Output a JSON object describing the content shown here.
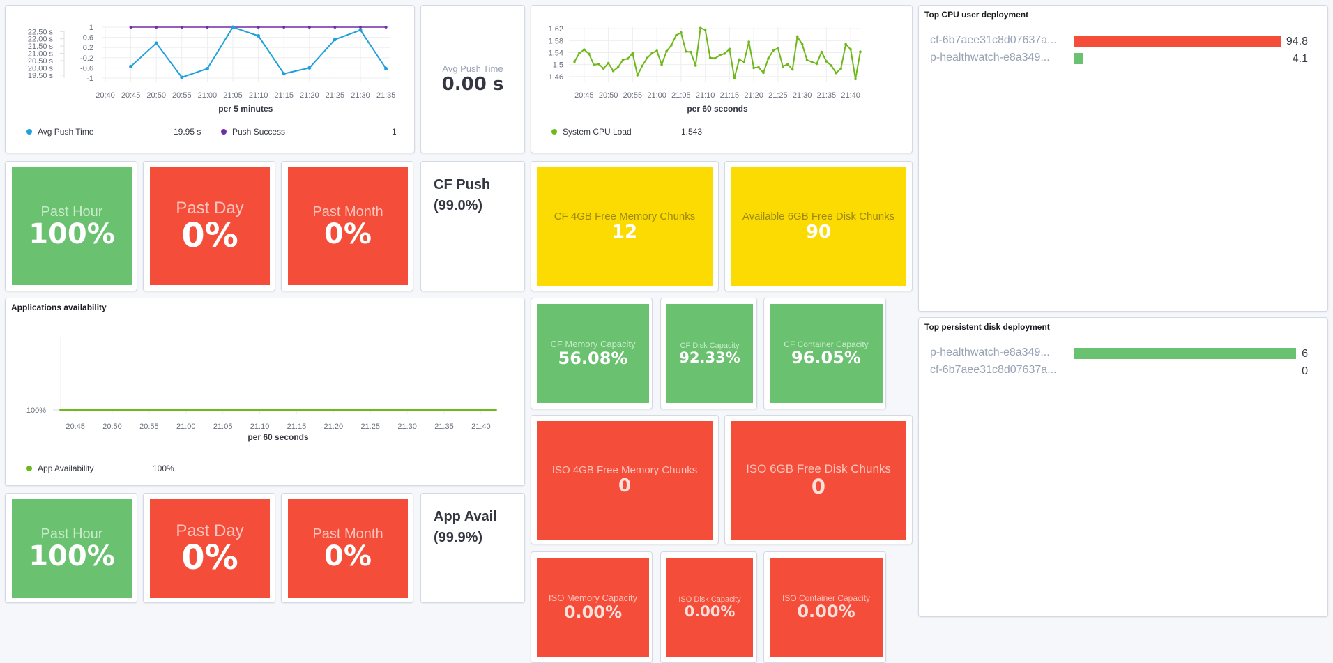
{
  "push_chart": {
    "axis_title": "per 5 minutes",
    "left_ticks": [
      "22.50 s",
      "22.00 s",
      "21.50 s",
      "21.00 s",
      "20.50 s",
      "20.00 s",
      "19.50 s"
    ],
    "right_ticks": [
      "1",
      "0.6",
      "0.2",
      "-0.2",
      "-0.6",
      "-1"
    ],
    "legend": [
      {
        "label": "Avg Push Time",
        "value": "19.95 s",
        "color": "#1ea0dc"
      },
      {
        "label": "Push Success",
        "value": "1",
        "color": "#6f2da8"
      }
    ]
  },
  "avg_push_tile": {
    "label": "Avg Push Time",
    "value": "0.00 s"
  },
  "cpu_chart": {
    "axis_title": "per 60 seconds",
    "legend": [
      {
        "label": "System CPU Load",
        "value": "1.543",
        "color": "#6eb81a"
      }
    ]
  },
  "cf_push": {
    "title": "CF Push",
    "subtitle": "(99.0%)",
    "tiles": [
      {
        "label": "Past Hour",
        "value": "100%",
        "status": "green"
      },
      {
        "label": "Past Day",
        "value": "0%",
        "status": "red"
      },
      {
        "label": "Past Month",
        "value": "0%",
        "status": "red"
      }
    ]
  },
  "chunks_cf": [
    {
      "label": "CF 4GB Free Memory Chunks",
      "value": "12"
    },
    {
      "label": "Available 6GB Free Disk Chunks",
      "value": "90"
    }
  ],
  "capacity_cf": [
    {
      "label": "CF Memory Capacity",
      "value": "56.08%"
    },
    {
      "label": "CF Disk Capacity",
      "value": "92.33%"
    },
    {
      "label": "CF Container Capacity",
      "value": "96.05%"
    }
  ],
  "chunks_iso": [
    {
      "label": "ISO 4GB Free Memory Chunks",
      "value": "0"
    },
    {
      "label": "ISO 6GB Free Disk Chunks",
      "value": "0"
    }
  ],
  "capacity_iso": [
    {
      "label": "ISO Memory Capacity",
      "value": "0.00%"
    },
    {
      "label": "ISO Disk Capacity",
      "value": "0.00%"
    },
    {
      "label": "ISO Container Capacity",
      "value": "0.00%"
    }
  ],
  "app_chart": {
    "title": "Applications availability",
    "axis_title": "per 60 seconds",
    "legend": [
      {
        "label": "App Availability",
        "value": "100%",
        "color": "#6eb81a"
      }
    ]
  },
  "app_avail": {
    "title": "App Avail",
    "subtitle": "(99.9%)",
    "tiles": [
      {
        "label": "Past Hour",
        "value": "100%",
        "status": "green"
      },
      {
        "label": "Past Day",
        "value": "0%",
        "status": "red"
      },
      {
        "label": "Past Month",
        "value": "0%",
        "status": "red"
      }
    ]
  },
  "top_cpu": {
    "title": "Top CPU user deployment",
    "rows": [
      {
        "label": "cf-6b7aee31c8d07637a...",
        "value": "94.8",
        "num": 94.8,
        "color": "#f44e3b"
      },
      {
        "label": "p-healthwatch-e8a349...",
        "value": "4.1",
        "num": 4.1,
        "color": "#6ac170"
      }
    ]
  },
  "top_disk": {
    "title": "Top persistent disk deployment",
    "rows": [
      {
        "label": "p-healthwatch-e8a349...",
        "value": "6",
        "num": 6,
        "color": "#6ac170"
      },
      {
        "label": "cf-6b7aee31c8d07637a...",
        "value": "0",
        "num": 0,
        "color": "#6ac170"
      }
    ]
  },
  "chart_data": [
    {
      "type": "line",
      "title": "",
      "xlabel": "per 5 minutes",
      "x": [
        "20:45",
        "20:50",
        "20:55",
        "21:00",
        "21:05",
        "21:10",
        "21:15",
        "21:20",
        "21:25",
        "21:30",
        "21:35"
      ],
      "x_ticks": [
        "20:40",
        "20:45",
        "20:50",
        "20:55",
        "21:00",
        "21:05",
        "21:10",
        "21:15",
        "21:20",
        "21:25",
        "21:30",
        "21:35"
      ],
      "series": [
        {
          "name": "Avg Push Time",
          "axis": "left",
          "unit": "s",
          "values": [
            20.1,
            21.7,
            19.35,
            19.95,
            22.8,
            22.2,
            19.6,
            20.0,
            21.95,
            22.6,
            19.95
          ]
        },
        {
          "name": "Push Success",
          "axis": "right",
          "values": [
            1,
            1,
            1,
            1,
            1,
            1,
            1,
            1,
            1,
            1,
            1
          ]
        }
      ],
      "ylim_left": [
        19.3,
        22.8
      ],
      "ylim_right": [
        -1,
        1
      ],
      "grid": true,
      "legend": "bottom"
    },
    {
      "type": "line",
      "title": "",
      "xlabel": "per 60 seconds",
      "x_ticks": [
        "20:45",
        "20:50",
        "20:55",
        "21:00",
        "21:05",
        "21:10",
        "21:15",
        "21:20",
        "21:25",
        "21:30",
        "21:35",
        "21:40"
      ],
      "x_start": "20:43",
      "x_step_minutes": 1,
      "y_ticks": [
        "1.62",
        "1.58",
        "1.54",
        "1.5",
        "1.46"
      ],
      "series": [
        {
          "name": "System CPU Load",
          "values": [
            1.51,
            1.538,
            1.55,
            1.536,
            1.499,
            1.502,
            1.487,
            1.505,
            1.479,
            1.491,
            1.516,
            1.52,
            1.538,
            1.465,
            1.496,
            1.522,
            1.538,
            1.546,
            1.5,
            1.544,
            1.565,
            1.598,
            1.607,
            1.544,
            1.542,
            1.497,
            1.622,
            1.616,
            1.523,
            1.521,
            1.531,
            1.537,
            1.552,
            1.455,
            1.517,
            1.509,
            1.576,
            1.489,
            1.491,
            1.473,
            1.52,
            1.547,
            1.555,
            1.494,
            1.501,
            1.484,
            1.593,
            1.568,
            1.515,
            1.509,
            1.503,
            1.542,
            1.511,
            1.497,
            1.472,
            1.487,
            1.568,
            1.551,
            1.452,
            1.543
          ]
        }
      ],
      "ylim": [
        1.455,
        1.625
      ],
      "grid": true,
      "legend": "bottom"
    },
    {
      "type": "line",
      "title": "Applications availability",
      "xlabel": "per 60 seconds",
      "x_ticks": [
        "20:45",
        "20:50",
        "20:55",
        "21:00",
        "21:05",
        "21:10",
        "21:15",
        "21:20",
        "21:25",
        "21:30",
        "21:35",
        "21:40"
      ],
      "y_ticks": [
        "100%"
      ],
      "series": [
        {
          "name": "App Availability",
          "values": [
            100,
            100,
            100,
            100,
            100,
            100,
            100,
            100,
            100,
            100,
            100,
            100,
            100,
            100,
            100,
            100,
            100,
            100,
            100,
            100,
            100,
            100,
            100,
            100,
            100,
            100,
            100,
            100,
            100,
            100,
            100,
            100,
            100,
            100,
            100,
            100,
            100,
            100,
            100,
            100,
            100,
            100,
            100,
            100,
            100,
            100,
            100,
            100,
            100,
            100,
            100,
            100,
            100,
            100,
            100,
            100,
            100,
            100,
            100,
            100
          ]
        }
      ],
      "grid": false,
      "legend": "bottom"
    },
    {
      "type": "bar",
      "title": "Top CPU user deployment",
      "categories": [
        "cf-6b7aee31c8d07637a...",
        "p-healthwatch-e8a349..."
      ],
      "values": [
        94.8,
        4.1
      ]
    },
    {
      "type": "bar",
      "title": "Top persistent disk deployment",
      "categories": [
        "p-healthwatch-e8a349...",
        "cf-6b7aee31c8d07637a..."
      ],
      "values": [
        6,
        0
      ]
    }
  ]
}
